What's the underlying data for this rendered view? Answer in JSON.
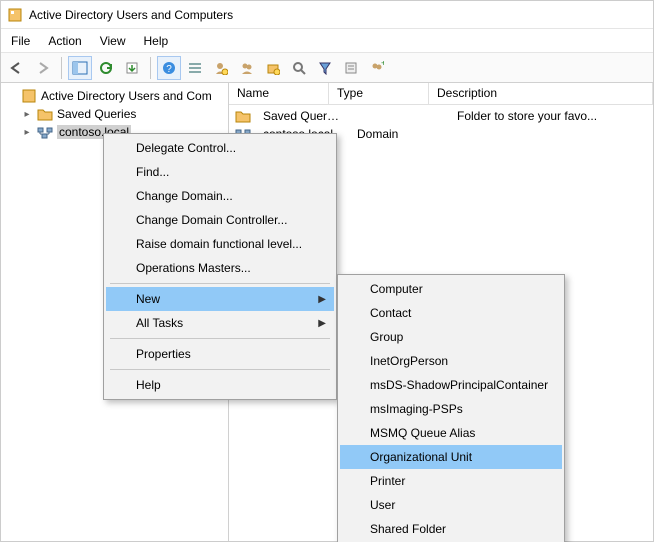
{
  "window": {
    "title": "Active Directory Users and Computers"
  },
  "menubar": {
    "file": "File",
    "action": "Action",
    "view": "View",
    "help": "Help"
  },
  "tree": {
    "root": "Active Directory Users and Com",
    "saved_queries": "Saved Queries",
    "domain": "contoso.local"
  },
  "columns": {
    "name": "Name",
    "type": "Type",
    "description": "Description"
  },
  "rows": [
    {
      "name": "Saved Queries",
      "type": "",
      "desc": "Folder to store your favo..."
    },
    {
      "name": "contoso.local",
      "type": "Domain",
      "desc": ""
    }
  ],
  "ctx1": {
    "delegate": "Delegate Control...",
    "find": "Find...",
    "change_domain": "Change Domain...",
    "change_dc": "Change Domain Controller...",
    "raise_level": "Raise domain functional level...",
    "ops_masters": "Operations Masters...",
    "new": "New",
    "all_tasks": "All Tasks",
    "properties": "Properties",
    "help": "Help"
  },
  "ctx2": {
    "computer": "Computer",
    "contact": "Contact",
    "group": "Group",
    "inetorg": "InetOrgPerson",
    "shadow": "msDS-ShadowPrincipalContainer",
    "msimaging": "msImaging-PSPs",
    "msmq": "MSMQ Queue Alias",
    "ou": "Organizational Unit",
    "printer": "Printer",
    "user": "User",
    "shared_folder": "Shared Folder"
  }
}
